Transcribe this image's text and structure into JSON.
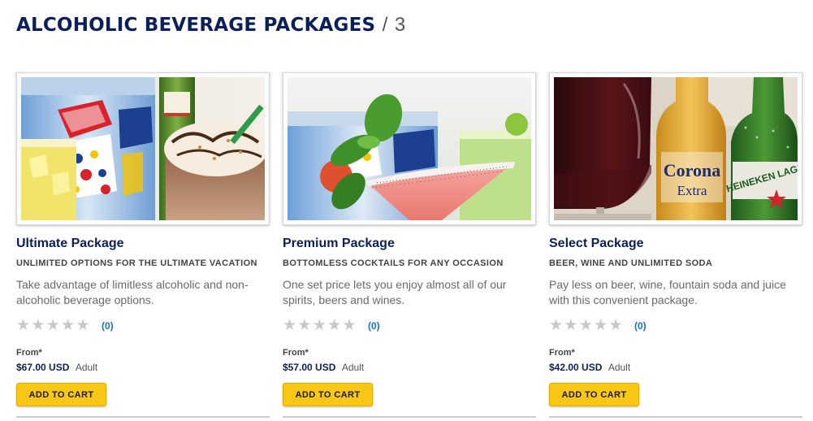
{
  "page": {
    "title": "ALCOHOLIC BEVERAGE PACKAGES",
    "separator": "/",
    "count": "3"
  },
  "icons": {
    "star": "star-icon"
  },
  "colors": {
    "title_navy": "#0b1f5c",
    "link_blue": "#1a6fc4",
    "cart_yellow": "#f8c614",
    "star_gray": "#c8c8c8"
  },
  "packages": [
    {
      "title": "Ultimate Package",
      "subtitle": "UNLIMITED OPTIONS FOR THE ULTIMATE VACATION",
      "description": "Take advantage of limitless alcoholic and non-alcoholic beverage options.",
      "rating": 0,
      "review_count": "(0)",
      "from_label": "From*",
      "price": "$67.00 USD",
      "price_unit": "Adult",
      "button_label": "ADD TO CART"
    },
    {
      "title": "Premium Package",
      "subtitle": "BOTTOMLESS COCKTAILS FOR ANY OCCASION",
      "description": "One set price lets you enjoy almost all of our spirits, beers and wines.",
      "rating": 0,
      "review_count": "(0)",
      "from_label": "From*",
      "price": "$57.00 USD",
      "price_unit": "Adult",
      "button_label": "ADD TO CART"
    },
    {
      "title": "Select Package",
      "subtitle": "BEER, WINE AND UNLIMITED SODA",
      "description": "Pay less on beer, wine, fountain soda and juice with this convenient package.",
      "rating": 0,
      "review_count": "(0)",
      "from_label": "From*",
      "price": "$42.00 USD",
      "price_unit": "Adult",
      "button_label": "ADD TO CART"
    }
  ],
  "photo_text": {
    "corona_brand": "Corona",
    "corona_sub": "Extra",
    "heineken_brand": "HEINEKEN LAGE"
  }
}
